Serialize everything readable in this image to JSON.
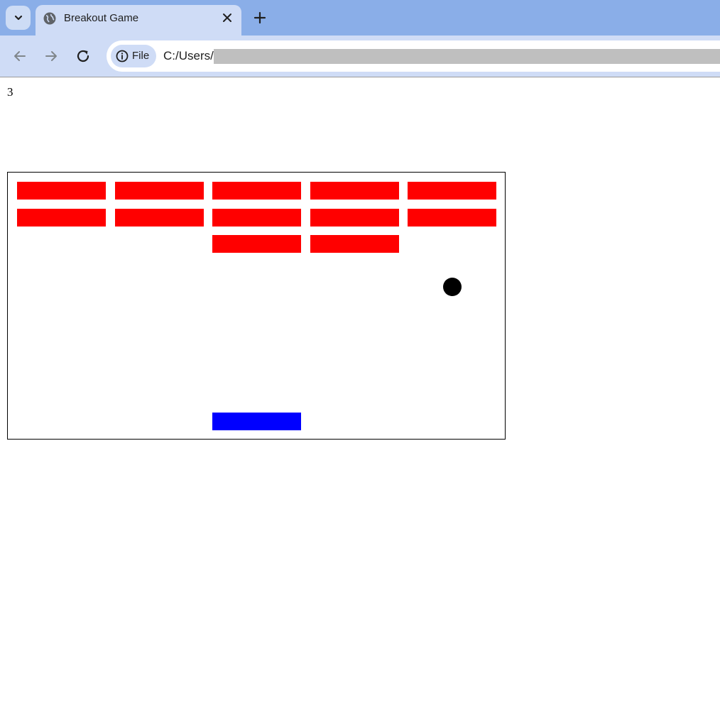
{
  "browser": {
    "tab": {
      "title": "Breakout Game"
    },
    "toolbar": {
      "chip_label": "File",
      "url": "C:/Users/"
    }
  },
  "page": {
    "lives": "3"
  },
  "game": {
    "brick_color": "#ff0000",
    "paddle_color": "#0000ff",
    "ball_color": "#000000",
    "bricks": [
      {
        "row": 0,
        "col": 0
      },
      {
        "row": 0,
        "col": 1
      },
      {
        "row": 0,
        "col": 2
      },
      {
        "row": 0,
        "col": 3
      },
      {
        "row": 0,
        "col": 4
      },
      {
        "row": 1,
        "col": 0
      },
      {
        "row": 1,
        "col": 1
      },
      {
        "row": 1,
        "col": 2
      },
      {
        "row": 1,
        "col": 3
      },
      {
        "row": 1,
        "col": 4
      },
      {
        "row": 2,
        "col": 2
      },
      {
        "row": 2,
        "col": 3
      }
    ]
  },
  "icons": {
    "tab_search": "chevron-down-icon",
    "favicon": "globe-icon",
    "close": "close-icon",
    "new_tab": "plus-icon",
    "back": "arrow-left-icon",
    "forward": "arrow-right-icon",
    "reload": "reload-icon",
    "site_info": "info-icon"
  }
}
